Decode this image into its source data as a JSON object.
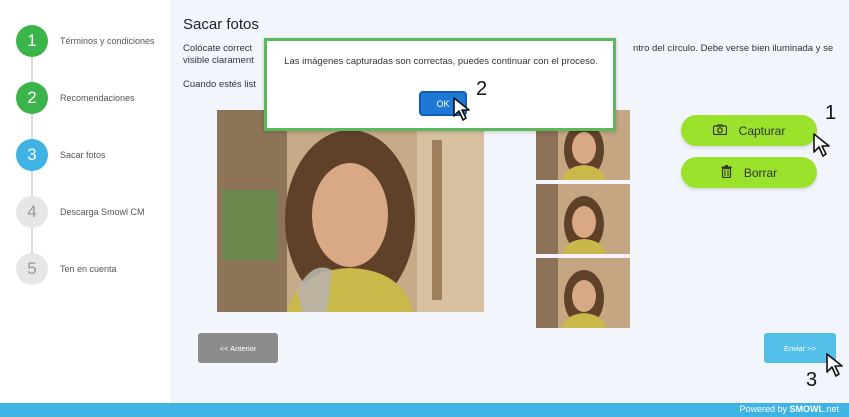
{
  "steps": [
    {
      "num": "1",
      "label": "Términos y condiciones",
      "state": "done"
    },
    {
      "num": "2",
      "label": "Recomendaciones",
      "state": "done"
    },
    {
      "num": "3",
      "label": "Sacar fotos",
      "state": "current"
    },
    {
      "num": "4",
      "label": "Descarga Smowl CM",
      "state": "pending"
    },
    {
      "num": "5",
      "label": "Ten en cuenta",
      "state": "pending"
    }
  ],
  "main": {
    "title": "Sacar fotos",
    "intro_line1_left": "Colócate correct",
    "intro_line1_right": "ntro del círculo. Debe verse bien iluminada y se",
    "intro_line2": "visible clarament",
    "intro_line3": "Cuando estés list",
    "capture_label": "Capturar",
    "delete_label": "Borrar",
    "prev_label": "<< Anterior",
    "send_label": "Enviar >>"
  },
  "modal": {
    "message": "Las imágenes capturadas son correctas, puedes continuar con el proceso.",
    "ok_label": "OK"
  },
  "annotations": {
    "a1": "1",
    "a2": "2",
    "a3": "3"
  },
  "footer": {
    "powered_prefix": "Powered by ",
    "brand": "SMOWL",
    "suffix": ".net"
  },
  "icons": {
    "capture": "camera-icon",
    "delete": "trash-icon"
  },
  "colors": {
    "done": "#3bb54a",
    "current": "#3fb3e3",
    "action": "#9be22d",
    "primary": "#1d78d6"
  }
}
